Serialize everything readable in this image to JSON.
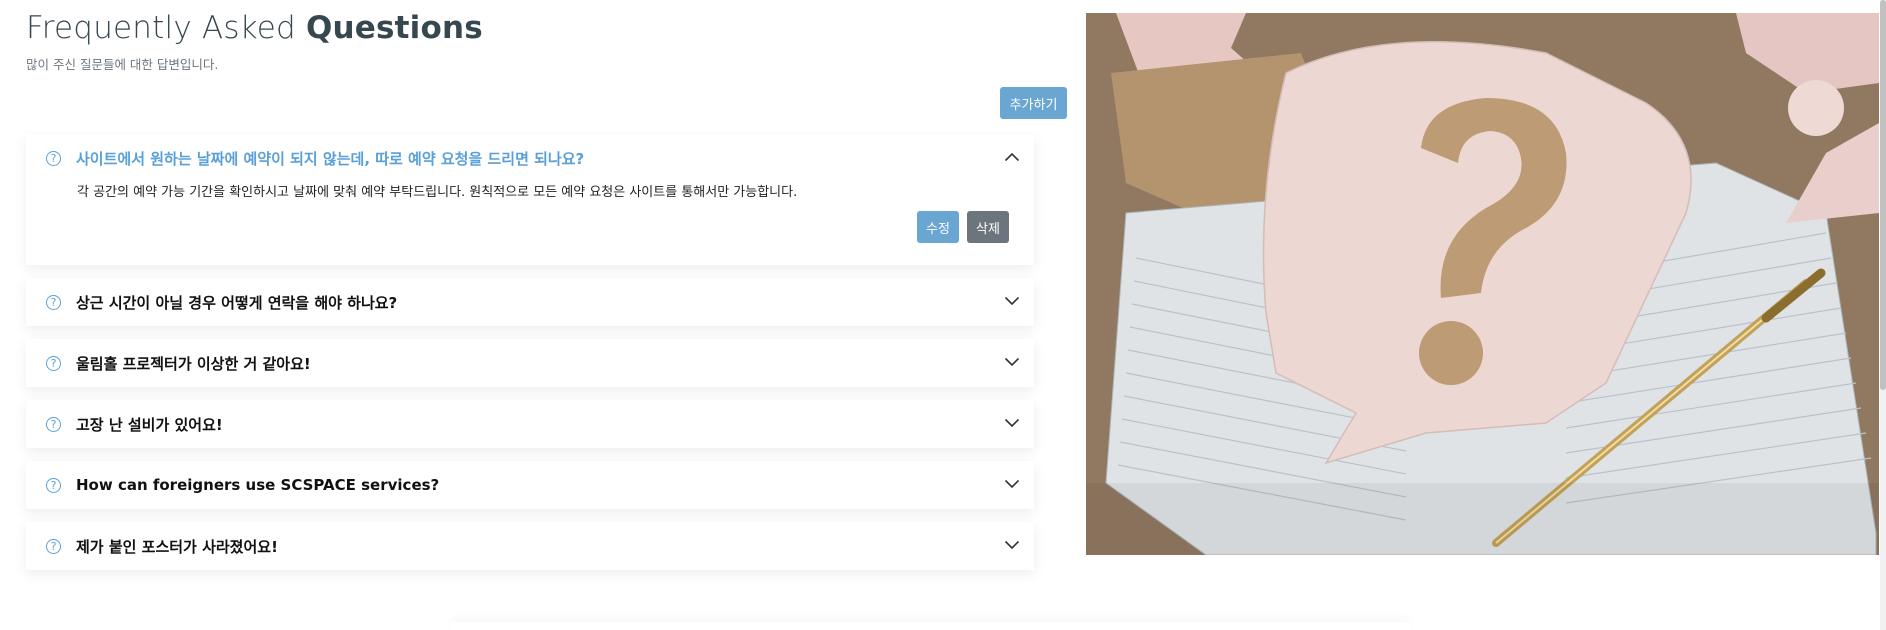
{
  "page": {
    "title_light": "Frequently Asked ",
    "title_bold": "Questions",
    "subtitle": "많이 주신 질문들에 대한 답변입니다.",
    "add_button": "추가하기"
  },
  "faq": {
    "items": [
      {
        "question": "사이트에서 원하는 날짜에 예약이 되지 않는데, 따로 예약 요청을 드리면 되나요?",
        "answer": "각 공간의 예약 가능 기간을 확인하시고 날짜에 맞춰 예약 부탁드립니다. 원칙적으로 모든 예약 요청은 사이트를 통해서만 가능합니다.",
        "expanded": true,
        "edit_label": "수정",
        "delete_label": "삭제"
      },
      {
        "question": "상근 시간이 아닐 경우 어떻게 연락을 해야 하나요?",
        "expanded": false
      },
      {
        "question": "울림홀 프로젝터가 이상한 거 같아요!",
        "expanded": false
      },
      {
        "question": "고장 난 설비가 있어요!",
        "expanded": false
      },
      {
        "question": "How can foreigners use SCSPACE services?",
        "expanded": false
      },
      {
        "question": "제가 붙인 포스터가 사라졌어요!",
        "expanded": false
      }
    ]
  },
  "icons": {
    "question": "question-circle-icon",
    "expand": "chevron-down-icon",
    "collapse": "chevron-up-icon"
  },
  "colors": {
    "accent": "#5aa0d8",
    "button_primary": "#6aa6d2",
    "button_secondary": "#6c757d",
    "title": "#37474f"
  }
}
